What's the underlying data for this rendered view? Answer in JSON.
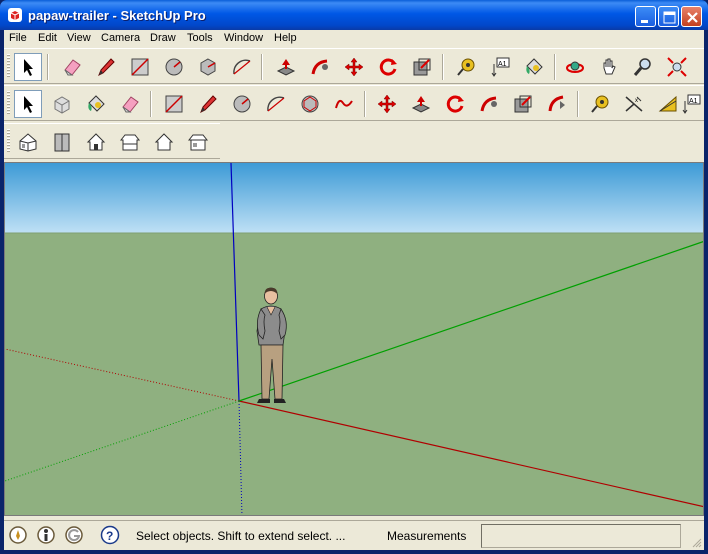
{
  "window": {
    "title": "papaw-trailer - SketchUp Pro"
  },
  "menu": [
    "File",
    "Edit",
    "View",
    "Camera",
    "Draw",
    "Tools",
    "Window",
    "Help"
  ],
  "toolbar_large": {
    "tools": [
      "select-icon",
      "eraser-icon",
      "pencil-icon",
      "rectangle-icon",
      "circle-icon",
      "polygon-icon",
      "arc-icon",
      "push-pull-icon",
      "follow-me-icon",
      "move-icon",
      "rotate-icon",
      "scale-icon",
      "tape-measure-icon",
      "text-icon",
      "paint-bucket-icon",
      "orbit-icon",
      "pan-icon",
      "zoom-icon",
      "zoom-extents-icon"
    ]
  },
  "toolbar_small": {
    "tools": [
      "select-icon",
      "make-component-icon",
      "paint-bucket-icon",
      "eraser-icon",
      "rectangle-icon",
      "pencil-icon",
      "circle-icon",
      "arc-icon",
      "polygon-icon",
      "freehand-icon",
      "move-icon",
      "push-pull-icon",
      "rotate-icon",
      "follow-me-icon",
      "scale-icon",
      "offset-icon",
      "tape-measure-icon",
      "dimension-icon",
      "protractor-icon",
      "text-icon"
    ]
  },
  "toolbar_views": {
    "tools": [
      "iso-view-icon",
      "top-view-icon",
      "front-view-icon",
      "right-view-icon",
      "back-view-icon",
      "left-view-icon"
    ]
  },
  "status": {
    "icons": [
      "geo-location-icon",
      "credits-icon",
      "sign-in-icon",
      "help-icon"
    ],
    "message": "Select objects. Shift to extend select. ...",
    "measurements_label": "Measurements",
    "measurements_value": ""
  },
  "colors": {
    "sky_top": "#3d9ad6",
    "sky_bottom": "#bfe0f5",
    "ground": "#8fb080",
    "red_axis": "#b00000",
    "green_axis": "#00a000",
    "blue_axis": "#0000c0"
  }
}
